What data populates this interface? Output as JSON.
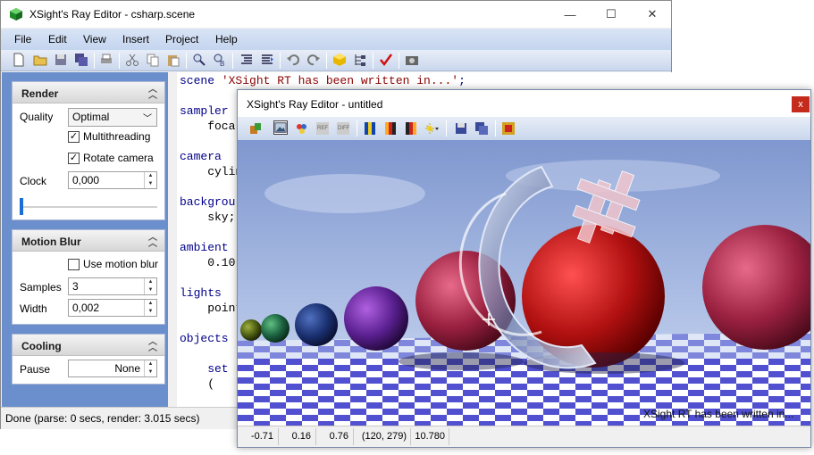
{
  "main_window": {
    "title": "XSight's Ray Editor - csharp.scene",
    "controls": {
      "minimize": "—",
      "maximize": "☐",
      "close": "✕"
    },
    "menu": [
      "File",
      "Edit",
      "View",
      "Insert",
      "Project",
      "Help"
    ],
    "toolbar_icons": [
      "new-file-icon",
      "open-folder-icon",
      "save-icon",
      "save-all-icon",
      "print-icon",
      "cut-icon",
      "copy-icon",
      "paste-icon",
      "find-icon",
      "replace-icon",
      "indent-icon",
      "outdent-icon",
      "undo-icon",
      "redo-icon",
      "cube-icon",
      "tree-icon",
      "check-icon",
      "camera-icon"
    ],
    "render_panel": {
      "header": "Render",
      "quality_label": "Quality",
      "quality_value": "Optimal",
      "multithreading_label": "Multithreading",
      "multithreading_checked": true,
      "rotate_label": "Rotate camera",
      "rotate_checked": true,
      "clock_label": "Clock",
      "clock_value": "0,000",
      "clock_slider": 0.0
    },
    "motion_panel": {
      "header": "Motion Blur",
      "use_label": "Use motion blur",
      "use_checked": false,
      "samples_label": "Samples",
      "samples_value": "3",
      "width_label": "Width",
      "width_value": "0,002"
    },
    "cooling_panel": {
      "header": "Cooling",
      "pause_label": "Pause",
      "pause_value": "None"
    },
    "code": [
      {
        "text": "scene 'XSight RT has been written in...';",
        "color": "#00008b",
        "str": "'XSight RT has been written in...'"
      },
      {
        "text": "sampler",
        "color": "#00008b"
      },
      {
        "text": "    foca",
        "color": "#00008b"
      },
      {
        "text": "camera",
        "color": "#00008b"
      },
      {
        "text": "    cylin",
        "color": "#00008b"
      },
      {
        "text": "backgrou",
        "color": "#00008b"
      },
      {
        "text": "    sky;",
        "color": "#00008b"
      },
      {
        "text": "ambient",
        "color": "#00008b"
      },
      {
        "text": "    0.10",
        "color": "#00008b"
      },
      {
        "text": "lights",
        "color": "#00008b"
      },
      {
        "text": "    point",
        "color": "#00008b"
      },
      {
        "text": "objects",
        "color": "#00008b"
      },
      {
        "text": "    set",
        "color": "#00008b"
      },
      {
        "text": "    (",
        "color": "#00008b"
      }
    ],
    "status": "Done (parse: 0 secs, render: 3.015 secs)"
  },
  "render_window": {
    "title": "XSight's Ray Editor - untitled",
    "close": "x",
    "caption": "XSight RT has been written in...",
    "status": {
      "x": "-0.71",
      "y": "0.16",
      "z": "0.76",
      "pixel": "(120, 279)",
      "dist": "10.780"
    },
    "colors": {
      "sphere_red": "#c01818",
      "sky": "#8fa5d8",
      "checker_blue": "#5a5ad8"
    }
  }
}
